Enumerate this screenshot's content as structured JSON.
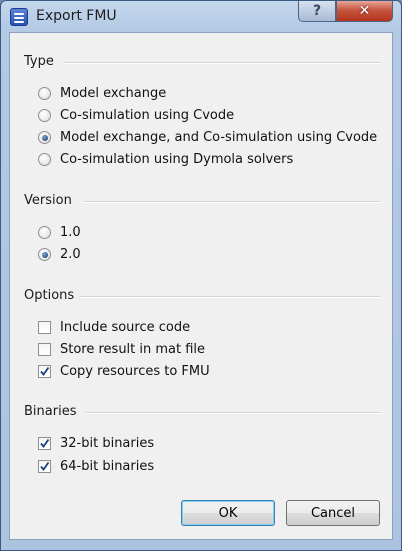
{
  "window": {
    "title": "Export FMU",
    "help_glyph": "?",
    "close_glyph": "✕"
  },
  "groups": {
    "type": {
      "title": "Type",
      "options": [
        {
          "label": "Model exchange",
          "selected": false
        },
        {
          "label": "Co-simulation using Cvode",
          "selected": false
        },
        {
          "label": "Model exchange, and Co-simulation using Cvode",
          "selected": true
        },
        {
          "label": "Co-simulation using Dymola solvers",
          "selected": false
        }
      ]
    },
    "version": {
      "title": "Version",
      "options": [
        {
          "label": "1.0",
          "selected": false
        },
        {
          "label": "2.0",
          "selected": true
        }
      ]
    },
    "options": {
      "title": "Options",
      "items": [
        {
          "label": "Include source code",
          "checked": false
        },
        {
          "label": "Store result in mat file",
          "checked": false
        },
        {
          "label": "Copy resources to FMU",
          "checked": true
        }
      ]
    },
    "binaries": {
      "title": "Binaries",
      "items": [
        {
          "label": "32-bit binaries",
          "checked": true
        },
        {
          "label": "64-bit binaries",
          "checked": true
        }
      ]
    }
  },
  "buttons": {
    "ok": "OK",
    "cancel": "Cancel"
  }
}
